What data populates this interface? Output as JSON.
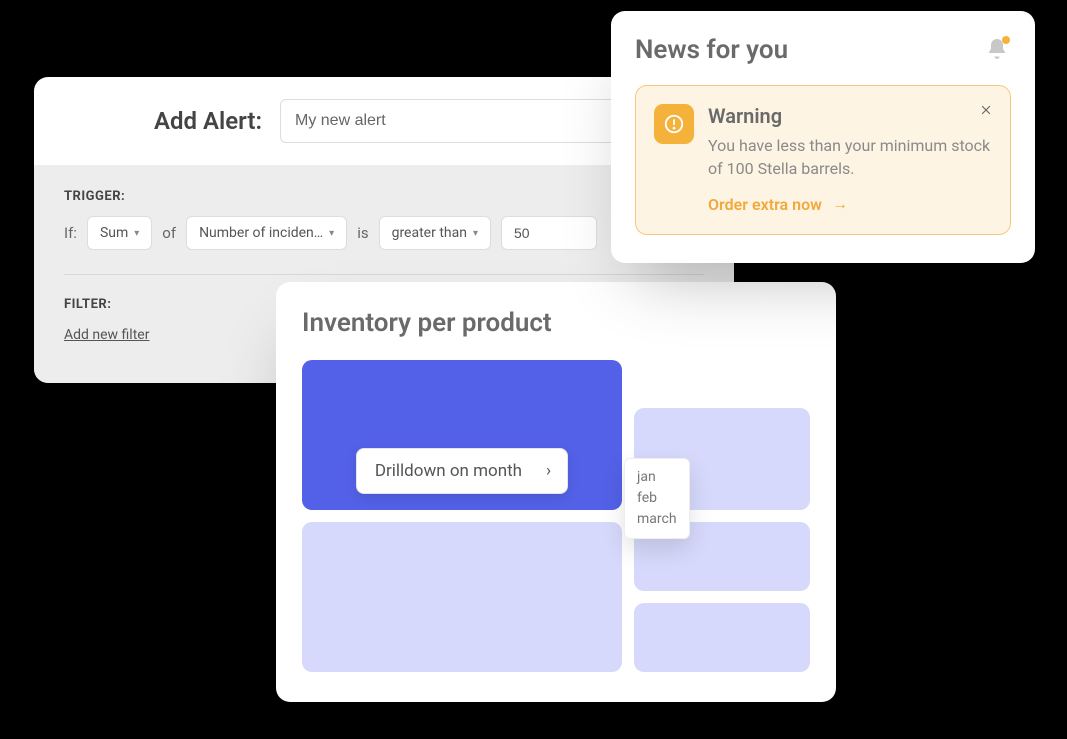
{
  "alert": {
    "title": "Add Alert:",
    "name_value": "My new alert",
    "trigger_label": "TRIGGER:",
    "if_word": "If:",
    "aggregate": "Sum",
    "of_word": "of",
    "metric": "Number of inciden…",
    "is_word": "is",
    "comparator": "greater than",
    "threshold": "50",
    "filter_label": "FILTER:",
    "add_filter": "Add new filter"
  },
  "inventory": {
    "title": "Inventory per product",
    "drilldown_label": "Drilldown on month",
    "months": [
      "jan",
      "feb",
      "march"
    ]
  },
  "news": {
    "title": "News for you",
    "warning_title": "Warning",
    "warning_body": "You have less than your minimum stock of 100 Stella barrels.",
    "cta": "Order extra now"
  },
  "colors": {
    "accent_blue": "#5361e8",
    "accent_amber": "#f5b23a"
  }
}
